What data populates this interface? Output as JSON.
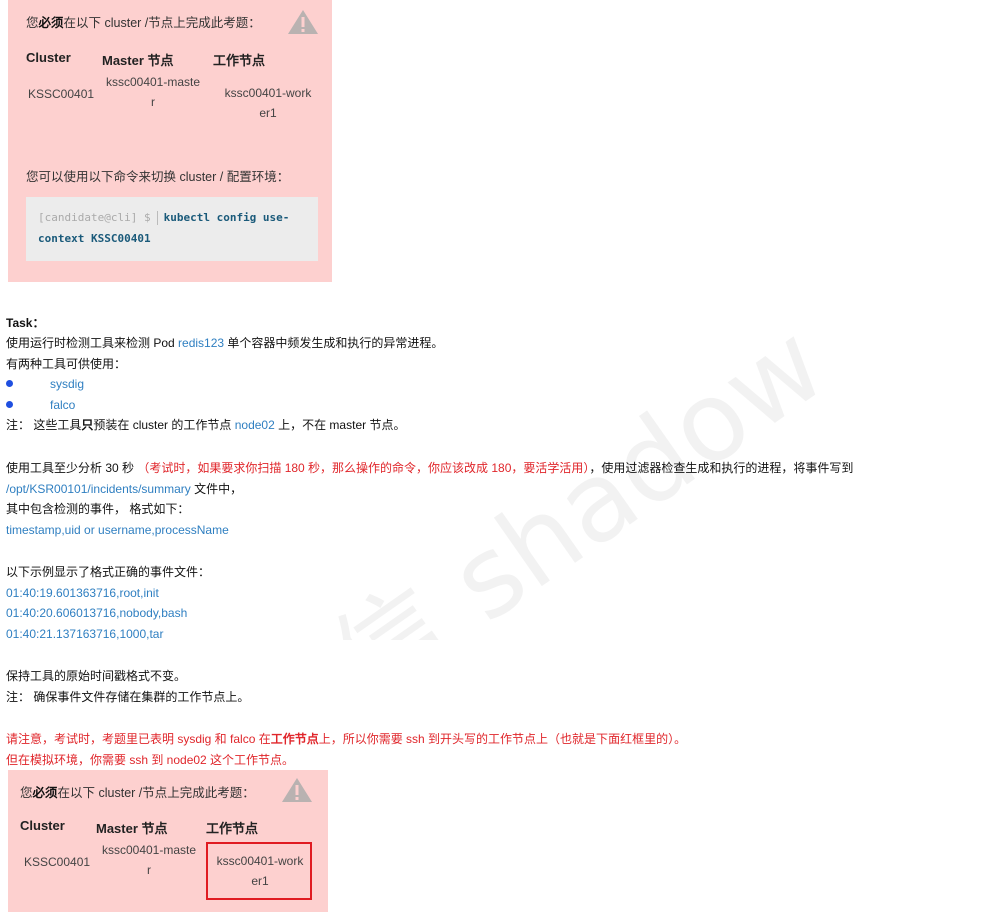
{
  "cluster_box": {
    "intro_pre": "您",
    "intro_bold": "必须",
    "intro_post": "在以下 cluster /节点上完成此考题：",
    "headers": [
      "Cluster",
      "Master 节点",
      "工作节点"
    ],
    "cluster": "KSSC00401",
    "master_line1": "kssc00401-maste",
    "master_line2": "r",
    "worker_line1": "kssc00401-work",
    "worker_line2": "er1",
    "switch_text": "您可以使用以下命令来切换 cluster / 配置环境：",
    "prompt": "[candidate@cli] $",
    "cmd_part1": "kubectl config use-",
    "cmd_part2": "context KSSC00401"
  },
  "task": {
    "title": "Task：",
    "line1_pre": "使用运行时检测工具来检测 Pod ",
    "pod": "redis123",
    "line1_post": " 单个容器中频发生成和执行的异常进程。",
    "line2": "有两种工具可供使用：",
    "tools": [
      "sysdig",
      "falco"
    ],
    "note1_pre": "注：  这些工具",
    "note1_bold": "只",
    "note1_mid": "预装在 cluster 的工作节点 ",
    "note1_node": "node02",
    "note1_post": " 上，不在  master  节点。",
    "analyze_pre": "使用工具至少分析 30 秒 ",
    "analyze_red": "（考试时，如果要求你扫描 180 秒，那么操作的命令，你应该改成 180，要活学活用）",
    "analyze_post": "，使用过滤器检查生成和执行的进程，将事件写到",
    "path": "/opt/KSR00101/incidents/summary",
    "path_post": " 文件中，",
    "format_line": "其中包含检测的事件，  格式如下：",
    "format": "timestamp,uid or username,processName",
    "example_intro": "以下示例显示了格式正确的事件文件：",
    "examples": [
      "01:40:19.601363716,root,init",
      "01:40:20.606013716,nobody,bash",
      "01:40:21.137163716,1000,tar"
    ],
    "keep": "保持工具的原始时间戳格式不变。",
    "note2": "注：  确保事件文件存储在集群的工作节点上。",
    "warn1_pre": "请注意，考试时，考题里已表明 sysdig 和 falco 在",
    "warn1_bold": "工作节点",
    "warn1_post": "上，所以你需要 ssh 到开头写的工作节点上（也就是下面红框里的）。",
    "warn2": "但在模拟环境，你需要 ssh 到 node02 这个工作节点。"
  },
  "watermark": "微信 shadow"
}
